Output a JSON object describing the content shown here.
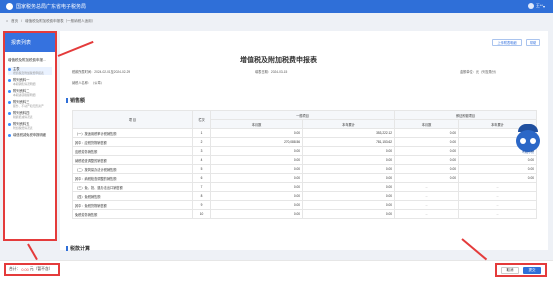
{
  "header": {
    "app_title": "国家税务总局广东省电子税务局",
    "user": "王**"
  },
  "breadcrumb": [
    "首页",
    "增值税及附加税费申报表（一般纳税人适用）"
  ],
  "sidebar": {
    "title": "报表列表",
    "section": "增值税及附加税费申报...",
    "items": [
      {
        "label": "主表",
        "sub": "增值税及附加税费申报表"
      },
      {
        "label": "附列资料一",
        "sub": "本期销售情况明细"
      },
      {
        "label": "附列资料二",
        "sub": "本期进项税额明细"
      },
      {
        "label": "附列资料三",
        "sub": "服务、不动产和无形资产"
      },
      {
        "label": "附列资料四",
        "sub": "税额抵减情况表"
      },
      {
        "label": "附列资料五",
        "sub": "附加税费情况表"
      },
      {
        "label": "增值税减免税申报明细",
        "sub": ""
      }
    ]
  },
  "toolbar": {
    "btn_import": "上传附表明细",
    "btn_help": "帮助"
  },
  "form": {
    "title": "增值税及附加税费申报表",
    "period": "税款所属时间：2024-02-01至2024-02-29",
    "fill_date": "填表日期：2024-03-15",
    "unit": "金额单位：元（列至角分）",
    "taxpayer": "纳税人名称：（公章）"
  },
  "sections": {
    "sales": "销售额",
    "tax_calc": "税款计算"
  },
  "table": {
    "headers": {
      "item": "项 目",
      "col": "栏次",
      "general": "一般项目",
      "refund": "即征即退项目",
      "cur": "本月数",
      "ytd": "本年累计"
    },
    "rows": [
      {
        "item": "（一）按适用税率计税销售额",
        "col": "1",
        "v1": "0.00",
        "v2": "353,222.12",
        "v3": "0.00",
        "v4": "0.00"
      },
      {
        "item": "其中：应税货物销售额",
        "col": "2",
        "v1": "270,088.56",
        "v2": "781,153.62",
        "v3": "0.00",
        "v4": "0.00"
      },
      {
        "item": "应税劳务销售额",
        "col": "3",
        "v1": "0.00",
        "v2": "0.00",
        "v3": "0.00",
        "v4": "0.00"
      },
      {
        "item": "纳税检查调整的销售额",
        "col": "4",
        "v1": "0.00",
        "v2": "0.00",
        "v3": "0.00",
        "v4": "0.00"
      },
      {
        "item": "（二）按简易办法计税销售额",
        "col": "5",
        "v1": "0.00",
        "v2": "0.00",
        "v3": "0.00",
        "v4": "0.00"
      },
      {
        "item": "其中：纳税检查调整的销售额",
        "col": "6",
        "v1": "0.00",
        "v2": "0.00",
        "v3": "0.00",
        "v4": "0.00"
      },
      {
        "item": "（三）免、抵、退办法出口销售额",
        "col": "7",
        "v1": "0.00",
        "v2": "0.00",
        "v3": "--",
        "v4": "--"
      },
      {
        "item": "（四）免税销售额",
        "col": "8",
        "v1": "0.00",
        "v2": "0.00",
        "v3": "--",
        "v4": "--"
      },
      {
        "item": "其中：免税货物销售额",
        "col": "9",
        "v1": "0.00",
        "v2": "0.00",
        "v3": "--",
        "v4": "--"
      },
      {
        "item": "免税劳务销售额",
        "col": "10",
        "v1": "0.00",
        "v2": "0.00",
        "v3": "--",
        "v4": "--"
      }
    ]
  },
  "mascot": {
    "label": "粤税小智"
  },
  "footer": {
    "total_label": "合计：",
    "amount": "0.00",
    "unit_label": "元（暂不含）",
    "btn_cancel": "取消",
    "btn_submit": "提交"
  },
  "colors": {
    "accent": "#2f6fd8",
    "highlight": "#e43b3b"
  }
}
